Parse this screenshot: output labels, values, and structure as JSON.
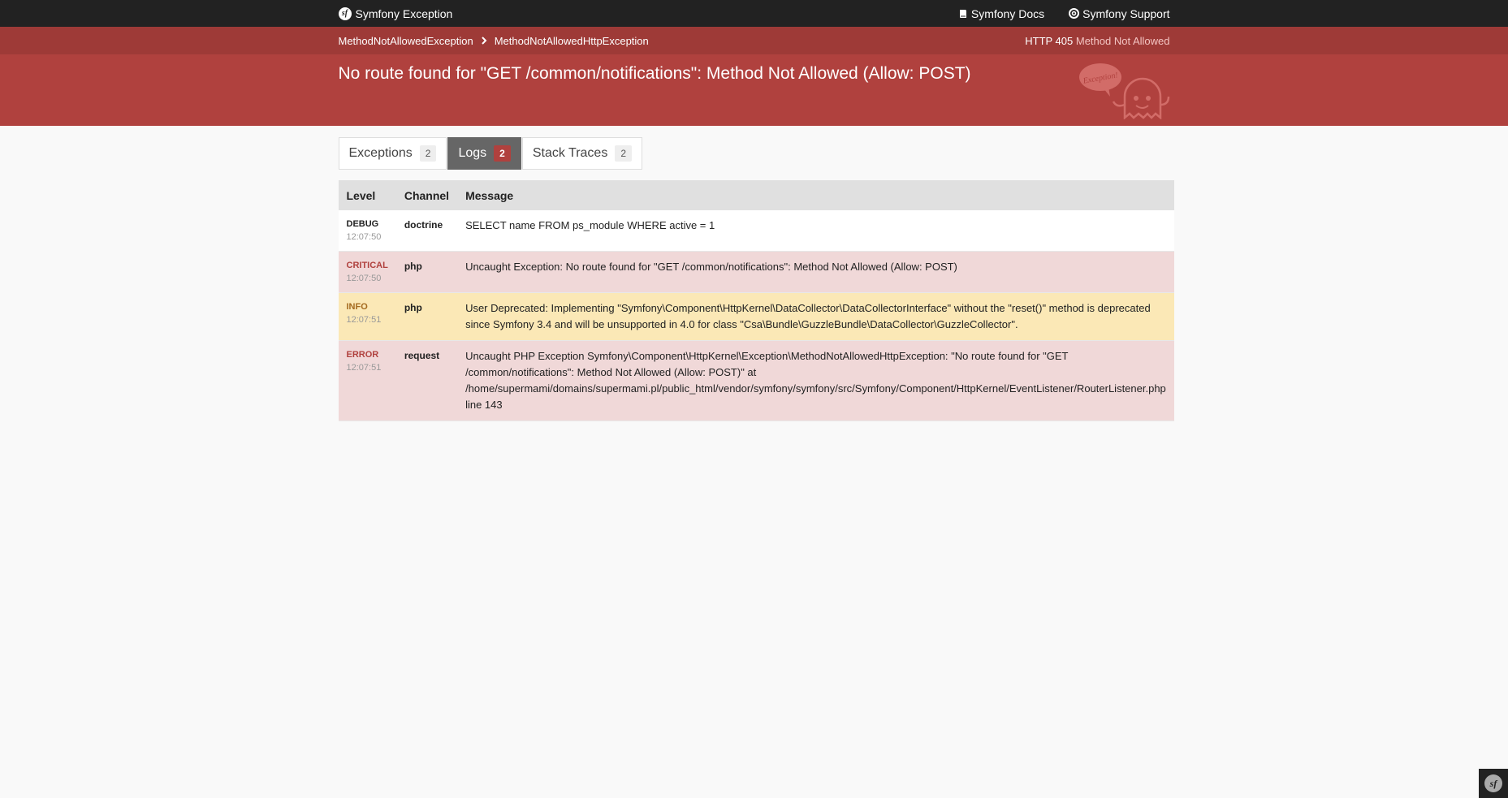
{
  "topbar": {
    "brand": "Symfony Exception",
    "links": [
      {
        "label": "Symfony Docs",
        "icon": "book-icon"
      },
      {
        "label": "Symfony Support",
        "icon": "lifebuoy-icon"
      }
    ]
  },
  "exception": {
    "breadcrumb": [
      "MethodNotAllowedException",
      "MethodNotAllowedHttpException"
    ],
    "http_code": "HTTP 405",
    "http_text": "Method Not Allowed",
    "title": "No route found for \"GET /common/notifications\": Method Not Allowed (Allow: POST)",
    "ghost_text": "Exception!"
  },
  "tabs": [
    {
      "label": "Exceptions",
      "count": "2",
      "active": false
    },
    {
      "label": "Logs",
      "count": "2",
      "active": true
    },
    {
      "label": "Stack Traces",
      "count": "2",
      "active": false
    }
  ],
  "logs": {
    "headers": [
      "Level",
      "Channel",
      "Message"
    ],
    "rows": [
      {
        "level": "DEBUG",
        "time": "12:07:50",
        "channel": "doctrine",
        "message": "SELECT name FROM ps_module WHERE active = 1"
      },
      {
        "level": "CRITICAL",
        "time": "12:07:50",
        "channel": "php",
        "message": "Uncaught Exception: No route found for \"GET /common/notifications\": Method Not Allowed (Allow: POST)"
      },
      {
        "level": "INFO",
        "time": "12:07:51",
        "channel": "php",
        "message": "User Deprecated: Implementing \"Symfony\\Component\\HttpKernel\\DataCollector\\DataCollectorInterface\" without the \"reset()\" method is deprecated since Symfony 3.4 and will be unsupported in 4.0 for class \"Csa\\Bundle\\GuzzleBundle\\DataCollector\\GuzzleCollector\"."
      },
      {
        "level": "ERROR",
        "time": "12:07:51",
        "channel": "request",
        "message": "Uncaught PHP Exception Symfony\\Component\\HttpKernel\\Exception\\MethodNotAllowedHttpException: \"No route found for \"GET /common/notifications\": Method Not Allowed (Allow: POST)\" at /home/supermami/domains/supermami.pl/public_html/vendor/symfony/symfony/src/Symfony/Component/HttpKernel/EventListener/RouterListener.php line 143"
      }
    ]
  },
  "colors": {
    "header_red": "#b0413e",
    "topbar": "#222222",
    "info_row": "#fbe8b6",
    "error_row": "#f0d8d8"
  }
}
